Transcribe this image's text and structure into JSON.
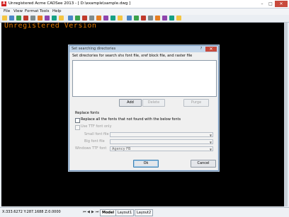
{
  "window": {
    "title": "Unregistered Acme CADSee 2013 - [ D:\\example\\sample.dwg ]",
    "app_icon": "A",
    "minimize": "–",
    "maximize": "□",
    "close": "✕"
  },
  "menu": [
    "File",
    "View",
    "Format",
    "Tools",
    "Help"
  ],
  "canvas": {
    "watermark": "Unregistered Version"
  },
  "status": {
    "coords": "X:333.6272 Y:287.1688 Z:0.0000",
    "nav": [
      "⏮",
      "◀",
      "▶",
      "⏭"
    ],
    "tabs": [
      "Model",
      "Layout1",
      "Layout2"
    ],
    "active_tab": "Model"
  },
  "dialog": {
    "title": "Set searching directories",
    "help": "?",
    "close": "✕",
    "description": "Set directories for search shx font file, xref block file, and raster file",
    "buttons": {
      "add": "Add",
      "delete": "Delete",
      "purge": "Purge",
      "ok": "Ok",
      "cancel": "Cancel"
    },
    "replace_fonts": {
      "heading": "Replace fonts",
      "replace_all_label": "Replace all the fonts that not found with the below fonts",
      "replace_all_checked": false,
      "use_ttf_label": "Use TTF font only",
      "use_ttf_checked": false,
      "small_font_label": "Small font file",
      "small_font_value": "",
      "big_font_label": "Big font file",
      "big_font_value": "",
      "windows_ttf_label": "Windows TTF font",
      "windows_ttf_value": "Agency FB"
    }
  },
  "colors": {
    "canvas": "#000000",
    "watermark": "#e07800",
    "dialog_title": "#c3d6ea",
    "close_red": "#c84a3c"
  },
  "toolbar_icons": [
    "new-icon",
    "open-icon",
    "save-icon",
    "print-icon",
    "cut-icon",
    "copy-icon",
    "paste-icon",
    "undo-icon",
    "redo-icon",
    "zoom-in-icon",
    "zoom-out-icon",
    "zoom-window-icon",
    "pan-icon",
    "zoom-extents-icon",
    "layers-icon",
    "properties-icon",
    "measure-icon",
    "text-icon",
    "line-icon",
    "rect-icon",
    "circle-icon",
    "arc-icon",
    "color-icon",
    "settings-icon",
    "help-icon"
  ]
}
